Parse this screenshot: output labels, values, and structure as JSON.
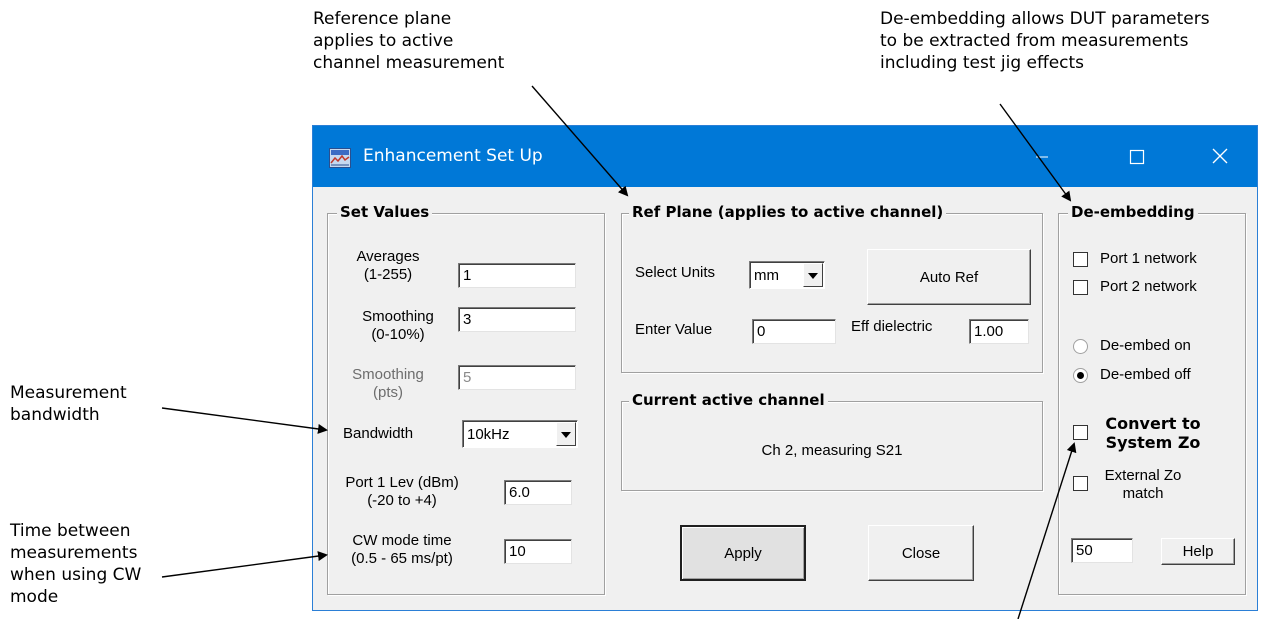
{
  "annotations": {
    "ref_plane": [
      "Reference plane",
      "applies to active",
      "channel measurement"
    ],
    "de_embedding": [
      "De-embedding allows DUT parameters",
      "to be extracted from measurements",
      "including test jig effects"
    ],
    "bandwidth": [
      "Measurement",
      "bandwidth"
    ],
    "cw_time": [
      "Time between",
      "measurements",
      "when using CW",
      "mode"
    ]
  },
  "window": {
    "title": "Enhancement Set Up",
    "buttons": {
      "minimize": "—",
      "maximize": "☐",
      "close": "✕"
    },
    "colors": {
      "titlebar": "#0078d7",
      "client": "#f0f0f0"
    }
  },
  "set_values": {
    "title": "Set Values",
    "averages_label": [
      "Averages",
      "(1-255)"
    ],
    "averages_value": "1",
    "smoothing_pct_label": [
      "Smoothing",
      "(0-10%)"
    ],
    "smoothing_pct_value": "3",
    "smoothing_pts_label": [
      "Smoothing",
      "(pts)"
    ],
    "smoothing_pts_value": "5",
    "bandwidth_label": "Bandwidth",
    "bandwidth_value": "10kHz",
    "port1_label": [
      "Port 1 Lev (dBm)",
      "(-20 to +4)"
    ],
    "port1_value": "6.0",
    "cw_label": [
      "CW mode time",
      "(0.5 - 65 ms/pt)"
    ],
    "cw_value": "10"
  },
  "ref_plane": {
    "title": "Ref Plane (applies to active channel)",
    "select_units_label": "Select Units",
    "units_value": "mm",
    "auto_ref_label": "Auto Ref",
    "enter_value_label": "Enter Value",
    "enter_value": "0",
    "eff_dielectric_label": "Eff dielectric",
    "eff_dielectric_value": "1.00"
  },
  "current_channel": {
    "title": "Current active channel",
    "text": "Ch 2, measuring S21"
  },
  "actions": {
    "apply": "Apply",
    "close": "Close"
  },
  "de_embedding": {
    "title": "De-embedding",
    "port1_network": "Port 1 network",
    "port2_network": "Port 2 network",
    "de_embed_on": "De-embed on",
    "de_embed_off": "De-embed off",
    "selected": "De-embed off",
    "convert_label": [
      "Convert to",
      "System Zo"
    ],
    "external_label": [
      "External Zo",
      "match"
    ],
    "zo_value": "50",
    "help_label": "Help"
  }
}
